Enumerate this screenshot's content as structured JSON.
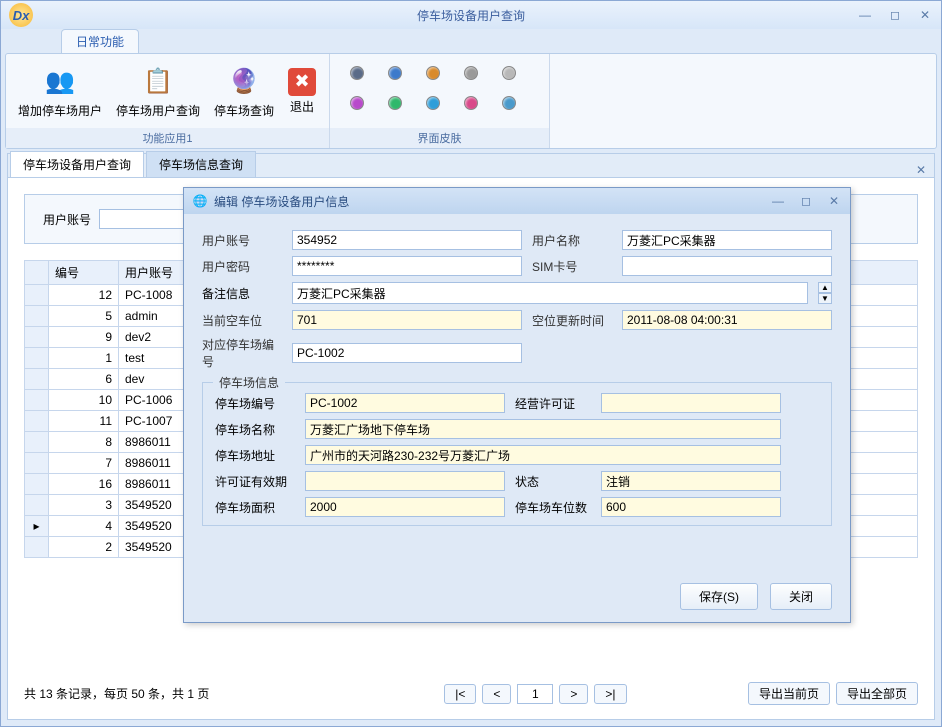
{
  "window": {
    "title": "停车场设备用户查询",
    "logo_text": "Dx"
  },
  "ribbon": {
    "tab": "日常功能",
    "group1": {
      "label": "功能应用1",
      "add_user": "增加停车场用户",
      "user_query": "停车场用户查询",
      "park_query": "停车场查询",
      "exit": "退出"
    },
    "group2": {
      "label": "界面皮肤"
    },
    "skins": [
      "#5a6b88",
      "#3d7acb",
      "#d98a2b",
      "#9a9a9a",
      "#b8b8b8",
      "#b84acb",
      "#2fb86b",
      "#2f9ed9",
      "#d94a8a",
      "#4a9acb"
    ]
  },
  "tabs": {
    "t1": "停车场设备用户查询",
    "t2": "停车场信息查询"
  },
  "search": {
    "label": "用户账号"
  },
  "table": {
    "col1": "编号",
    "col2": "用户账号",
    "rows": [
      {
        "id": "12",
        "acc": "PC-1008"
      },
      {
        "id": "5",
        "acc": "admin"
      },
      {
        "id": "9",
        "acc": "dev2"
      },
      {
        "id": "1",
        "acc": "test"
      },
      {
        "id": "6",
        "acc": "dev"
      },
      {
        "id": "10",
        "acc": "PC-1006"
      },
      {
        "id": "11",
        "acc": "PC-1007"
      },
      {
        "id": "8",
        "acc": "8986011"
      },
      {
        "id": "7",
        "acc": "8986011"
      },
      {
        "id": "16",
        "acc": "8986011"
      },
      {
        "id": "3",
        "acc": "3549520"
      },
      {
        "id": "4",
        "acc": "3549520"
      },
      {
        "id": "2",
        "acc": "3549520"
      }
    ]
  },
  "pager": {
    "info": "共 13 条记录，每页 50 条，共 1 页",
    "first": "|<",
    "prev": "<",
    "page": "1",
    "next": ">",
    "last": ">|",
    "export_cur": "导出当前页",
    "export_all": "导出全部页"
  },
  "modal": {
    "title": "编辑 停车场设备用户信息",
    "labels": {
      "account": "用户账号",
      "name": "用户名称",
      "password": "用户密码",
      "sim": "SIM卡号",
      "remark": "备注信息",
      "vacancy": "当前空车位",
      "update": "空位更新时间",
      "park_id": "对应停车场编号"
    },
    "values": {
      "account": "354952",
      "name": "万菱汇PC采集器",
      "password": "********",
      "sim": "",
      "remark": "万菱汇PC采集器",
      "vacancy": "701",
      "update": "2011-08-08 04:00:31",
      "park_id": "PC-1002"
    },
    "fieldset": {
      "legend": "停车场信息",
      "labels": {
        "pid": "停车场编号",
        "license": "经营许可证",
        "pname": "停车场名称",
        "paddr": "停车场地址",
        "valid": "许可证有效期",
        "status": "状态",
        "area": "停车场面积",
        "slots": "停车场车位数"
      },
      "values": {
        "pid": "PC-1002",
        "license": "",
        "pname": "万菱汇广场地下停车场",
        "paddr": "广州市的天河路230-232号万菱汇广场",
        "valid": "",
        "status": "注销",
        "area": "2000",
        "slots": "600"
      }
    },
    "save": "保存(S)",
    "close": "关闭"
  }
}
